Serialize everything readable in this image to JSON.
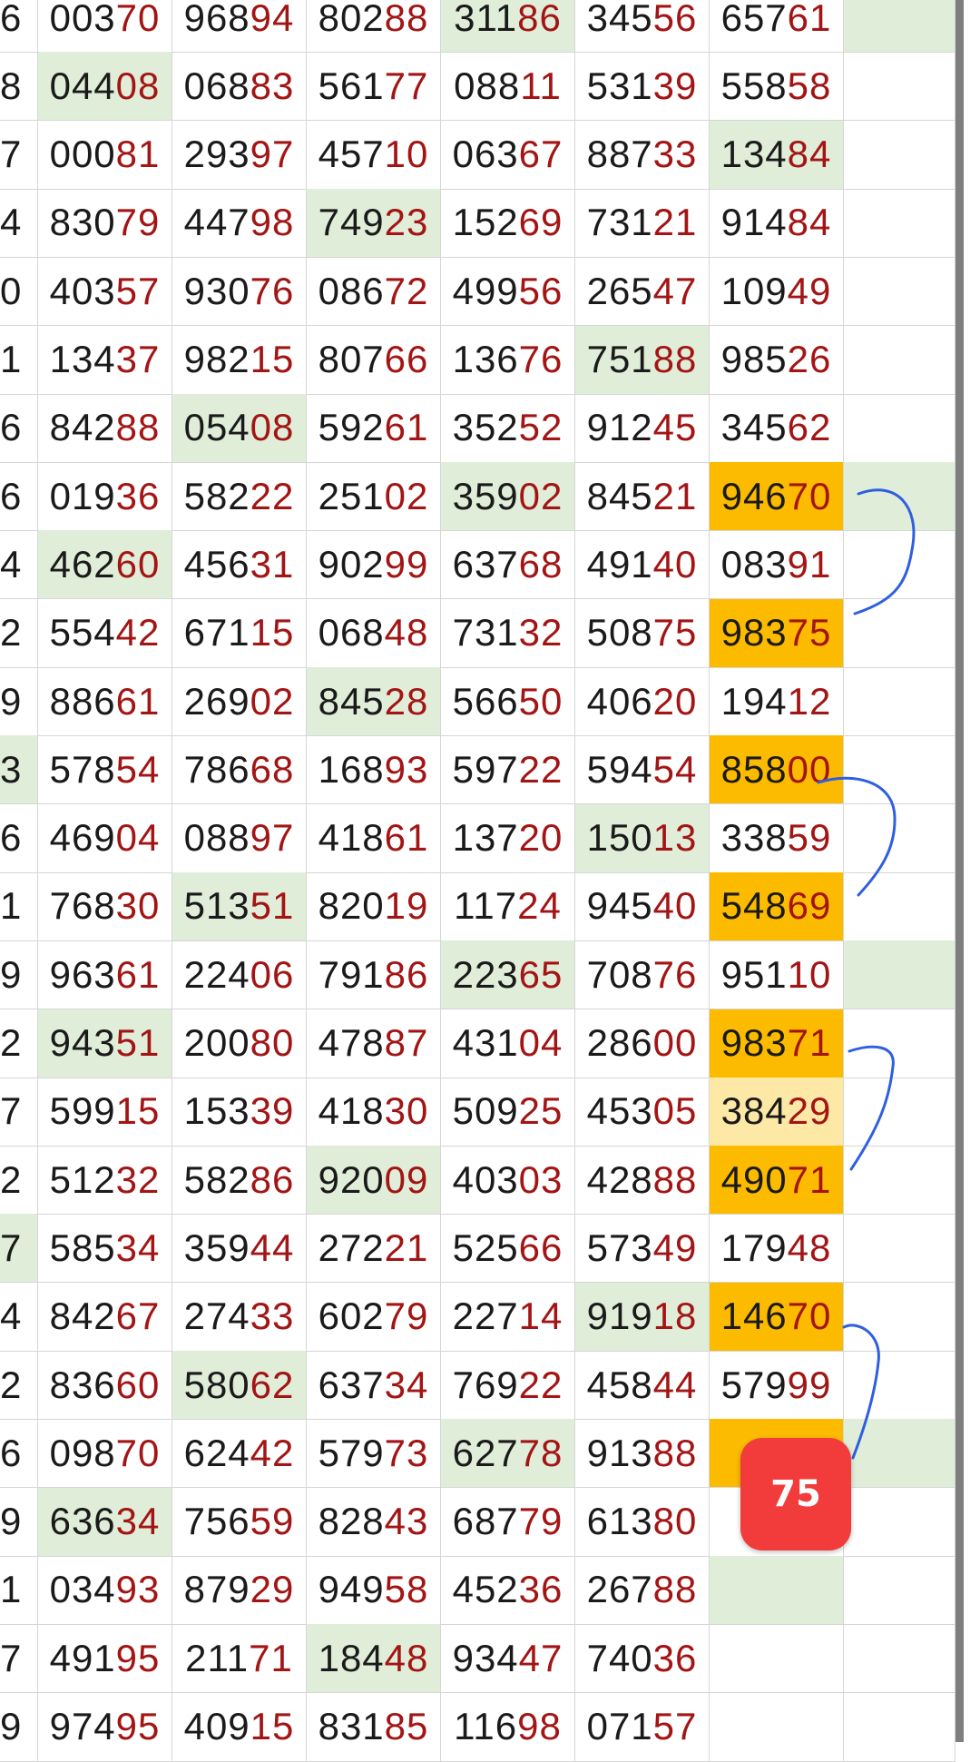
{
  "colors": {
    "green_highlight": "#e0eed9",
    "orange_highlight": "#fdbb00",
    "light_orange_highlight": "#fde9a5",
    "tail_digits": "#a31515",
    "badge": "#f23b3b",
    "annotation_stroke": "#2f5fe0"
  },
  "grid": {
    "rows": [
      {
        "cells": [
          "6",
          "00370",
          "96894",
          "80288",
          "31186",
          "34556",
          "65761",
          ""
        ],
        "green": [
          4,
          7
        ],
        "orange": [],
        "lightorange": []
      },
      {
        "cells": [
          "8",
          "04408",
          "06883",
          "56177",
          "08811",
          "53139",
          "55858",
          ""
        ],
        "green": [
          1
        ],
        "orange": [],
        "lightorange": []
      },
      {
        "cells": [
          "7",
          "00081",
          "29397",
          "45710",
          "06367",
          "88733",
          "13484",
          ""
        ],
        "green": [
          6
        ],
        "orange": [],
        "lightorange": []
      },
      {
        "cells": [
          "4",
          "83079",
          "44798",
          "74923",
          "15269",
          "73121",
          "91484",
          ""
        ],
        "green": [
          3
        ],
        "orange": [],
        "lightorange": []
      },
      {
        "cells": [
          "0",
          "40357",
          "93076",
          "08672",
          "49956",
          "26547",
          "10949",
          ""
        ],
        "green": [],
        "orange": [],
        "lightorange": []
      },
      {
        "cells": [
          "1",
          "13437",
          "98215",
          "80766",
          "13676",
          "75188",
          "98526",
          ""
        ],
        "green": [
          5
        ],
        "orange": [],
        "lightorange": []
      },
      {
        "cells": [
          "6",
          "84288",
          "05408",
          "59261",
          "35252",
          "91245",
          "34562",
          ""
        ],
        "green": [
          2
        ],
        "orange": [],
        "lightorange": []
      },
      {
        "cells": [
          "6",
          "01936",
          "58222",
          "25102",
          "35902",
          "84521",
          "94670",
          ""
        ],
        "green": [
          4,
          7
        ],
        "orange": [
          6
        ],
        "lightorange": []
      },
      {
        "cells": [
          "4",
          "46260",
          "45631",
          "90299",
          "63768",
          "49140",
          "08391",
          ""
        ],
        "green": [
          1
        ],
        "orange": [],
        "lightorange": []
      },
      {
        "cells": [
          "2",
          "55442",
          "67115",
          "06848",
          "73132",
          "50875",
          "98375",
          ""
        ],
        "green": [],
        "orange": [
          6
        ],
        "lightorange": []
      },
      {
        "cells": [
          "9",
          "88661",
          "26902",
          "84528",
          "56650",
          "40620",
          "19412",
          ""
        ],
        "green": [
          3
        ],
        "orange": [],
        "lightorange": []
      },
      {
        "cells": [
          "3",
          "57854",
          "78668",
          "16893",
          "59722",
          "59454",
          "85800",
          ""
        ],
        "green": [
          0
        ],
        "orange": [
          6
        ],
        "lightorange": []
      },
      {
        "cells": [
          "6",
          "46904",
          "08897",
          "41861",
          "13720",
          "15013",
          "33859",
          ""
        ],
        "green": [
          5
        ],
        "orange": [],
        "lightorange": []
      },
      {
        "cells": [
          "1",
          "76830",
          "51351",
          "82019",
          "11724",
          "94540",
          "54869",
          ""
        ],
        "green": [
          2
        ],
        "orange": [
          6
        ],
        "lightorange": []
      },
      {
        "cells": [
          "9",
          "96361",
          "22406",
          "79186",
          "22365",
          "70876",
          "95110",
          ""
        ],
        "green": [
          4,
          7
        ],
        "orange": [],
        "lightorange": []
      },
      {
        "cells": [
          "2",
          "94351",
          "20080",
          "47887",
          "43104",
          "28600",
          "98371",
          ""
        ],
        "green": [
          1
        ],
        "orange": [
          6
        ],
        "lightorange": []
      },
      {
        "cells": [
          "7",
          "59915",
          "15339",
          "41830",
          "50925",
          "45305",
          "38429",
          ""
        ],
        "green": [],
        "orange": [],
        "lightorange": [
          6
        ]
      },
      {
        "cells": [
          "2",
          "51232",
          "58286",
          "92009",
          "40303",
          "42888",
          "49071",
          ""
        ],
        "green": [
          3
        ],
        "orange": [
          6
        ],
        "lightorange": []
      },
      {
        "cells": [
          "7",
          "58534",
          "35944",
          "27221",
          "52566",
          "57349",
          "17948",
          ""
        ],
        "green": [
          0
        ],
        "orange": [],
        "lightorange": []
      },
      {
        "cells": [
          "4",
          "84267",
          "27433",
          "60279",
          "22714",
          "91918",
          "14670",
          ""
        ],
        "green": [
          5
        ],
        "orange": [
          6
        ],
        "lightorange": []
      },
      {
        "cells": [
          "2",
          "83660",
          "58062",
          "63734",
          "76922",
          "45844",
          "57999",
          ""
        ],
        "green": [
          2
        ],
        "orange": [],
        "lightorange": []
      },
      {
        "cells": [
          "6",
          "09870",
          "62442",
          "57973",
          "62778",
          "91388",
          "",
          ""
        ],
        "green": [
          4,
          7
        ],
        "orange": [
          6
        ],
        "lightorange": []
      },
      {
        "cells": [
          "9",
          "63634",
          "75659",
          "82843",
          "68779",
          "61380",
          "",
          ""
        ],
        "green": [
          1
        ],
        "orange": [],
        "lightorange": []
      },
      {
        "cells": [
          "1",
          "03493",
          "87929",
          "94958",
          "45236",
          "26788",
          "",
          ""
        ],
        "green": [
          6
        ],
        "orange": [],
        "lightorange": []
      },
      {
        "cells": [
          "7",
          "49195",
          "21171",
          "18448",
          "93447",
          "74036",
          "",
          ""
        ],
        "green": [
          3
        ],
        "orange": [],
        "lightorange": []
      },
      {
        "cells": [
          "9",
          "97495",
          "40915",
          "83185",
          "11698",
          "07157",
          "",
          ""
        ],
        "green": [],
        "orange": [],
        "lightorange": []
      }
    ]
  },
  "badge": {
    "text": "75"
  }
}
